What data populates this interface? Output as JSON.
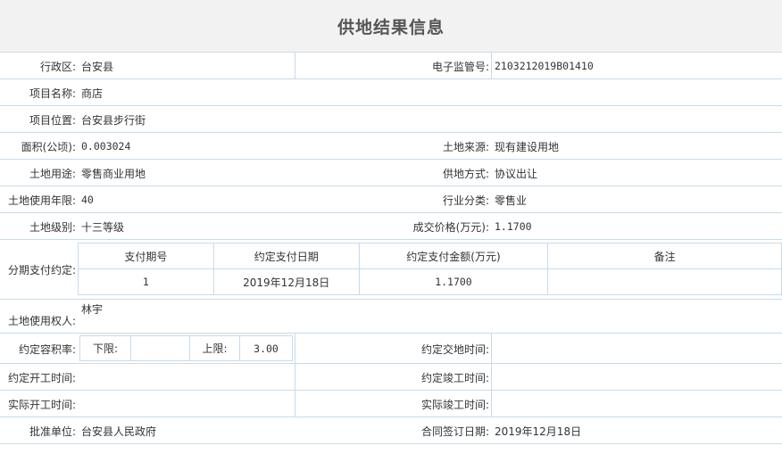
{
  "title": "供地结果信息",
  "fields": {
    "district_label": "行政区:",
    "district": "台安县",
    "supervision_label": "电子监管号:",
    "supervision": "2103212019B01410",
    "project_name_label": "项目名称:",
    "project_name": "商店",
    "project_location_label": "项目位置:",
    "project_location": "台安县步行街",
    "area_label": "面积(公顷):",
    "area": "0.003024",
    "land_source_label": "土地来源:",
    "land_source": "现有建设用地",
    "land_use_label": "土地用途:",
    "land_use": "零售商业用地",
    "supply_method_label": "供地方式:",
    "supply_method": "协议出让",
    "use_years_label": "土地使用年限:",
    "use_years": "40",
    "industry_label": "行业分类:",
    "industry": "零售业",
    "land_grade_label": "土地级别:",
    "land_grade": "十三等级",
    "price_label": "成交价格(万元):",
    "price": "1.1700",
    "installment_label": "分期支付约定:",
    "land_user_label": "土地使用权人:",
    "land_user": "林宇",
    "far_label": "约定容积率:",
    "far_lower_label": "下限:",
    "far_lower": "",
    "far_upper_label": "上限:",
    "far_upper": "3.00",
    "delivery_time_label": "约定交地时间:",
    "delivery_time": "",
    "start_agreed_label": "约定开工时间:",
    "start_agreed": "",
    "finish_agreed_label": "约定竣工时间:",
    "finish_agreed": "",
    "start_actual_label": "实际开工时间:",
    "start_actual": "",
    "finish_actual_label": "实际竣工时间:",
    "finish_actual": "",
    "approver_label": "批准单位:",
    "approver": "台安县人民政府",
    "contract_date_label": "合同签订日期:",
    "contract_date": "2019年12月18日"
  },
  "installments": {
    "headers": [
      "支付期号",
      "约定支付日期",
      "约定支付金额(万元)",
      "备注"
    ],
    "rows": [
      [
        "1",
        "2019年12月18日",
        "1.1700",
        ""
      ]
    ]
  }
}
